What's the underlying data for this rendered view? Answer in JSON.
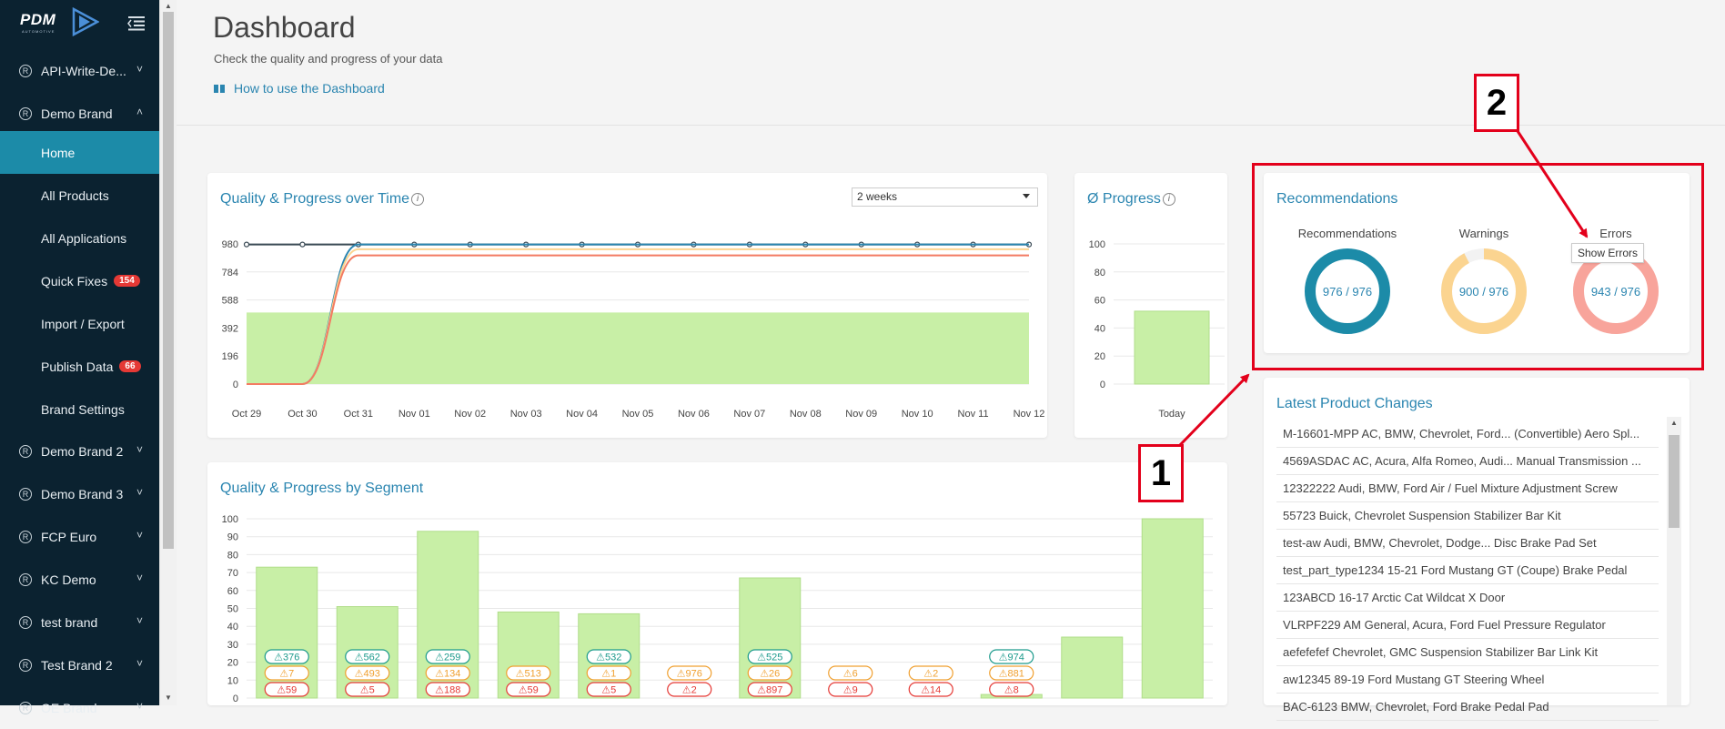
{
  "sidebar": {
    "logo_text": "PDM",
    "logo_sub": "AUTOMOTIVE",
    "items": [
      {
        "label": "API-Write-De...",
        "expanded": false
      },
      {
        "label": "Demo Brand",
        "expanded": true
      },
      {
        "label": "Demo Brand 2",
        "expanded": false
      },
      {
        "label": "Demo Brand 3",
        "expanded": false
      },
      {
        "label": "FCP Euro",
        "expanded": false
      },
      {
        "label": "KC Demo",
        "expanded": false
      },
      {
        "label": "test brand",
        "expanded": false
      },
      {
        "label": "Test Brand 2",
        "expanded": false
      },
      {
        "label": "OE Brand",
        "expanded": false
      }
    ],
    "subitems": [
      {
        "label": "Home",
        "active": true
      },
      {
        "label": "All Products"
      },
      {
        "label": "All Applications"
      },
      {
        "label": "Quick Fixes",
        "badge": "154"
      },
      {
        "label": "Import / Export"
      },
      {
        "label": "Publish Data",
        "badge": "66"
      },
      {
        "label": "Brand Settings"
      }
    ],
    "reg_symbol": "R"
  },
  "header": {
    "title": "Dashboard",
    "subtitle": "Check the quality and progress of your data",
    "howto": "How to use the Dashboard"
  },
  "time_card": {
    "title": "Quality & Progress over Time",
    "info": "i",
    "range_value": "2 weeks"
  },
  "progress_card": {
    "title": "Ø Progress",
    "info": "i"
  },
  "segment_card": {
    "title": "Quality & Progress by Segment"
  },
  "recommendations": {
    "title": "Recommendations",
    "donuts": [
      {
        "label": "Recommendations",
        "value": 976,
        "total": 976,
        "text": "976 / 976",
        "color": "#1c8ba8",
        "track": "#ffffff"
      },
      {
        "label": "Warnings",
        "value": 900,
        "total": 976,
        "text": "900 / 976",
        "color": "#fbd490",
        "track": "#f2f2f2"
      },
      {
        "label": "Errors",
        "value": 943,
        "total": 976,
        "text": "943 / 976",
        "color": "#f8a49b",
        "track": "#f2f2f2"
      }
    ],
    "tooltip": "Show Errors"
  },
  "latest": {
    "title": "Latest Product Changes",
    "rows": [
      "M-16601-MPP AC, BMW, Chevrolet, Ford... (Convertible) Aero Spl...",
      "4569ASDAC AC, Acura, Alfa Romeo, Audi... Manual Transmission ...",
      "12322222 Audi, BMW, Ford Air / Fuel Mixture Adjustment Screw",
      "55723 Buick, Chevrolet Suspension Stabilizer Bar Kit",
      "test-aw Audi, BMW, Chevrolet, Dodge... Disc Brake Pad Set",
      "test_part_type1234 15-21 Ford Mustang GT (Coupe) Brake Pedal",
      "123ABCD 16-17 Arctic Cat Wildcat X Door",
      "VLRPF229 AM General, Acura, Ford Fuel Pressure Regulator",
      "aefefefef Chevrolet, GMC Suspension Stabilizer Bar Link Kit",
      "aw12345 89-19 Ford Mustang GT Steering Wheel",
      "BAC-6123 BMW, Chevrolet, Ford Brake Pedal Pad"
    ]
  },
  "annotations": {
    "one": "1",
    "two": "2",
    "color": "#e3001b"
  },
  "chart_data": [
    {
      "type": "line",
      "title": "Quality & Progress over Time",
      "x": [
        "Oct 29",
        "Oct 30",
        "Oct 31",
        "Nov 01",
        "Nov 02",
        "Nov 03",
        "Nov 04",
        "Nov 05",
        "Nov 06",
        "Nov 07",
        "Nov 08",
        "Nov 09",
        "Nov 10",
        "Nov 11",
        "Nov 12"
      ],
      "yticks": [
        0,
        196,
        392,
        588,
        784,
        980
      ],
      "ylim": [
        0,
        980
      ],
      "series": [
        {
          "type": "area",
          "color": "#c8efa6",
          "values": [
            500,
            500,
            500,
            500,
            500,
            500,
            500,
            500,
            500,
            500,
            500,
            500,
            500,
            500,
            500
          ]
        },
        {
          "type": "line",
          "color": "#3a4a55",
          "values": [
            976,
            976,
            976,
            976,
            976,
            976,
            976,
            976,
            976,
            976,
            976,
            976,
            976,
            976,
            976
          ]
        },
        {
          "type": "line",
          "color": "#2a85b0",
          "values": [
            0,
            0,
            976,
            976,
            976,
            976,
            976,
            976,
            976,
            976,
            976,
            976,
            976,
            976,
            976
          ]
        },
        {
          "type": "line",
          "color": "#fbd490",
          "values": [
            0,
            0,
            943,
            943,
            943,
            943,
            943,
            943,
            943,
            943,
            943,
            943,
            943,
            943,
            943
          ]
        },
        {
          "type": "line",
          "color": "#f37b62",
          "values": [
            0,
            0,
            900,
            900,
            900,
            900,
            900,
            900,
            900,
            900,
            900,
            900,
            900,
            900,
            900
          ]
        }
      ],
      "grid": true
    },
    {
      "type": "bar",
      "title": "Ø Progress",
      "categories": [
        "Today"
      ],
      "values": [
        52
      ],
      "yticks": [
        0,
        20,
        40,
        60,
        80,
        100
      ],
      "ylim": [
        0,
        100
      ],
      "grid": true
    },
    {
      "type": "bar",
      "title": "Quality & Progress by Segment",
      "values": [
        73,
        51,
        93,
        48,
        47,
        0,
        67,
        0,
        0,
        2,
        34,
        100
      ],
      "yticks": [
        0,
        10,
        20,
        30,
        40,
        50,
        60,
        70,
        80,
        90,
        100
      ],
      "ylim": [
        0,
        100
      ],
      "badges": [
        {
          "t": "376",
          "w": "7",
          "e": "59"
        },
        {
          "t": "562",
          "w": "493",
          "e": "5"
        },
        {
          "t": "259",
          "w": "134",
          "e": "188"
        },
        {
          "t": "",
          "w": "513",
          "e": "59"
        },
        {
          "t": "532",
          "w": "1",
          "e": "5"
        },
        {
          "t": "",
          "w": "976",
          "e": "2"
        },
        {
          "t": "525",
          "w": "26",
          "e": "897"
        },
        {
          "t": "",
          "w": "6",
          "e": "9"
        },
        {
          "t": "",
          "w": "2",
          "e": "14"
        },
        {
          "t": "974",
          "w": "881",
          "e": "8"
        },
        {
          "t": "",
          "w": "",
          "e": ""
        },
        {
          "t": "",
          "w": "",
          "e": ""
        }
      ],
      "grid": true
    }
  ]
}
